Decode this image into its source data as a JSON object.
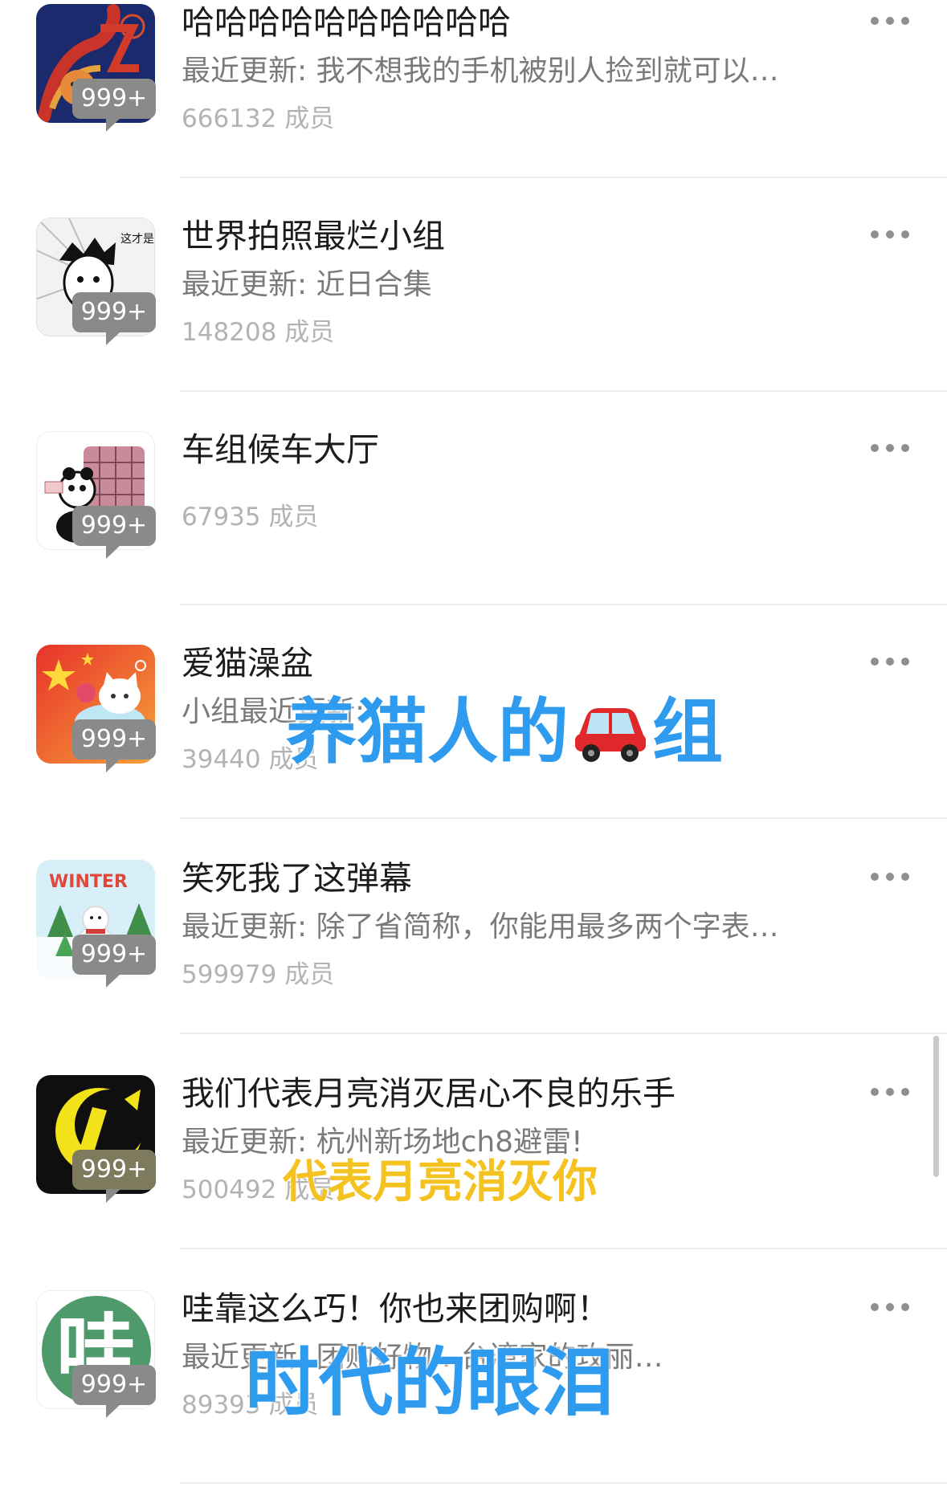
{
  "groups": [
    {
      "name": "哈哈哈哈哈哈哈哈哈哈",
      "update": "最近更新: 我不想我的手机被别人捡到就可以…",
      "members": "666132 成员",
      "badge": "999+",
      "avatar_icon": "dragon-avatar-icon"
    },
    {
      "name": "世界拍照最烂小组",
      "update": "最近更新: 近日合集",
      "members": "148208 成员",
      "badge": "999+",
      "avatar_icon": "manga-face-avatar-icon",
      "avatar_text": "这才是真正的摄影!!"
    },
    {
      "name": "车组候车大厅",
      "update": "",
      "members": "67935 成员",
      "badge": "999+",
      "avatar_icon": "panda-luggage-avatar-icon"
    },
    {
      "name": "爱猫澡盆",
      "update": "小组最近更新:",
      "members": "39440 成员",
      "badge": "999+",
      "avatar_icon": "cat-bath-avatar-icon"
    },
    {
      "name": "笑死我了这弹幕",
      "update": "最近更新: 除了省简称，你能用最多两个字表…",
      "members": "599979 成员",
      "badge": "999+",
      "avatar_icon": "winter-snowman-avatar-icon",
      "avatar_text": "WINTER"
    },
    {
      "name": "我们代表月亮消灭居心不良的乐手",
      "update": "最近更新: 杭州新场地ch8避雷!",
      "members": "500492 成员",
      "badge": "999+",
      "avatar_icon": "yellow-moon-avatar-icon"
    },
    {
      "name": "哇靠这么巧！你也来团购啊！",
      "update": "最近更新: 团购好物…台湾家的玫丽…",
      "members": "89393 成员",
      "badge": "999+",
      "avatar_icon": "wa-character-avatar-icon",
      "avatar_text": "哇"
    }
  ],
  "overlays": {
    "cat_caption_before": "养猫人的",
    "cat_caption_after": "组",
    "moon_caption": "代表月亮消灭你",
    "tears_caption": "时代的眼泪"
  },
  "colors": {
    "caption_blue": "#2e9bef",
    "caption_yellow": "#f4c322",
    "badge_gray": "#8a8a8a",
    "title": "#1c1c1c",
    "subtitle": "#7a7a7a",
    "members": "#b3b3b3"
  }
}
